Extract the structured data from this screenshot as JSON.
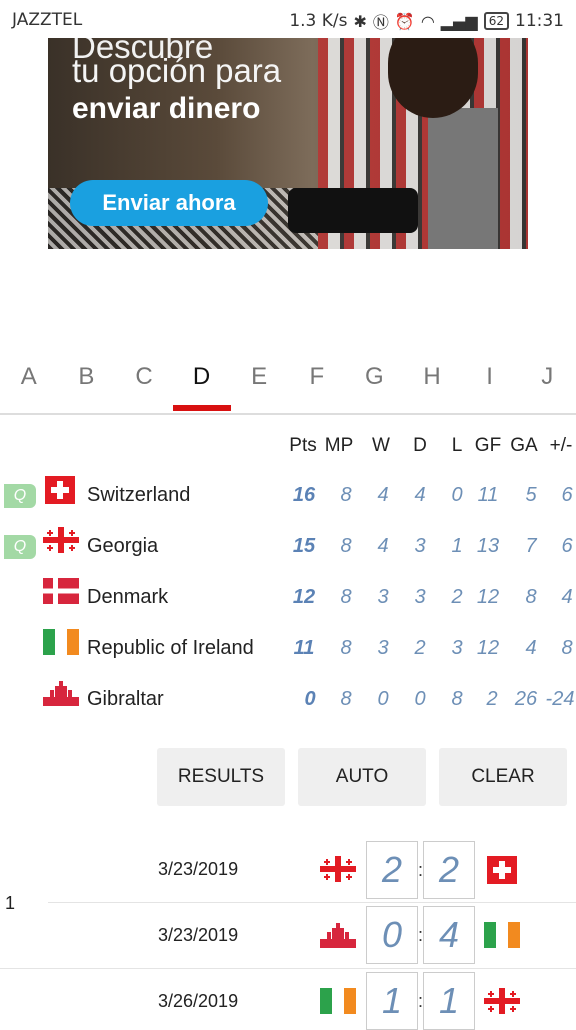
{
  "status_bar": {
    "carrier": "JAZZTEL",
    "speed": "1.3 K/s",
    "battery": "62",
    "time": "11:31"
  },
  "ad": {
    "line1": "Descubre",
    "line2": "tu opción para",
    "line3": "enviar dinero",
    "cta": "Enviar ahora"
  },
  "tabs": [
    "A",
    "B",
    "C",
    "D",
    "E",
    "F",
    "G",
    "H",
    "I",
    "J"
  ],
  "active_tab": "D",
  "standings": {
    "columns": [
      "Pts",
      "MP",
      "W",
      "D",
      "L",
      "GF",
      "GA",
      "+/-"
    ],
    "rows": [
      {
        "team": "Switzerland",
        "q": "Q",
        "flag": "switzerland-flag-icon",
        "pts": "16",
        "mp": "8",
        "w": "4",
        "d": "4",
        "l": "0",
        "gf": "11",
        "ga": "5",
        "gd": "6"
      },
      {
        "team": "Georgia",
        "q": "Q",
        "flag": "georgia-flag-icon",
        "pts": "15",
        "mp": "8",
        "w": "4",
        "d": "3",
        "l": "1",
        "gf": "13",
        "ga": "7",
        "gd": "6"
      },
      {
        "team": "Denmark",
        "q": "",
        "flag": "denmark-flag-icon",
        "pts": "12",
        "mp": "8",
        "w": "3",
        "d": "3",
        "l": "2",
        "gf": "12",
        "ga": "8",
        "gd": "4"
      },
      {
        "team": "Republic of Ireland",
        "q": "",
        "flag": "ireland-flag-icon",
        "pts": "11",
        "mp": "8",
        "w": "3",
        "d": "2",
        "l": "3",
        "gf": "12",
        "ga": "4",
        "gd": "8"
      },
      {
        "team": "Gibraltar",
        "q": "",
        "flag": "gibraltar-flag-icon",
        "pts": "0",
        "mp": "8",
        "w": "0",
        "d": "0",
        "l": "8",
        "gf": "2",
        "ga": "26",
        "gd": "-24"
      }
    ]
  },
  "buttons": {
    "results": "RESULTS",
    "auto": "AUTO",
    "clear": "CLEAR"
  },
  "matches": {
    "round": "1",
    "list": [
      {
        "date": "3/23/2019",
        "home_flag": "georgia-flag-icon",
        "home_score": "2",
        "away_score": "2",
        "away_flag": "switzerland-flag-icon"
      },
      {
        "date": "3/23/2019",
        "home_flag": "gibraltar-flag-icon",
        "home_score": "0",
        "away_score": "4",
        "away_flag": "ireland-flag-icon"
      },
      {
        "date": "3/26/2019",
        "home_flag": "ireland-flag-icon",
        "home_score": "1",
        "away_score": "1",
        "away_flag": "georgia-flag-icon"
      }
    ],
    "separator": ":"
  }
}
